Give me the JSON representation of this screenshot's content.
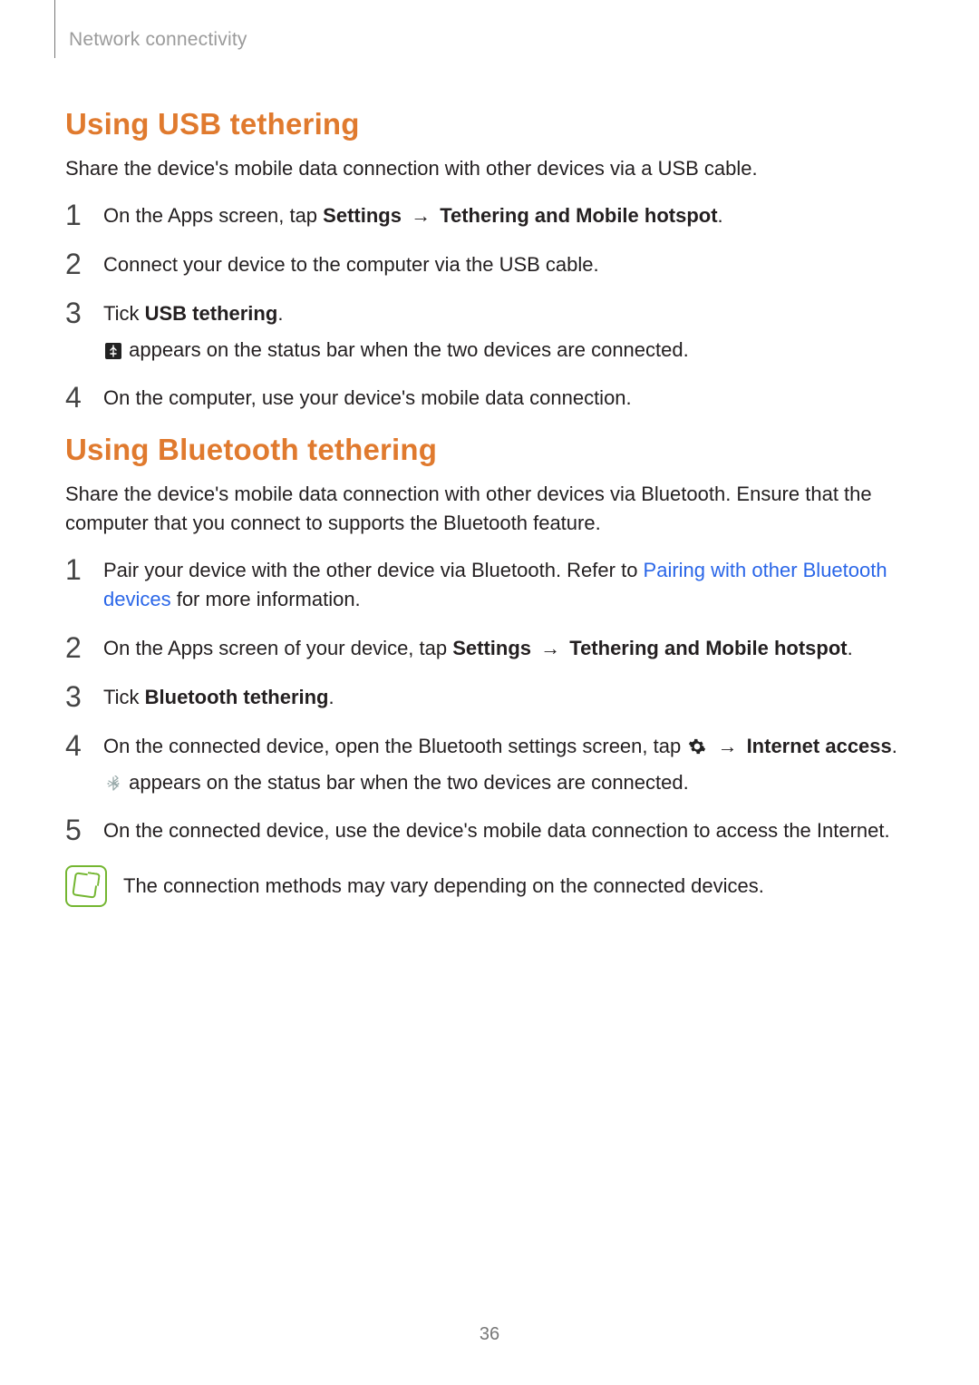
{
  "header": {
    "section": "Network connectivity"
  },
  "usb": {
    "heading": "Using USB tethering",
    "lead": "Share the device's mobile data connection with other devices via a USB cable.",
    "step1": {
      "pre": "On the Apps screen, tap ",
      "bold1": "Settings",
      "arrow": " → ",
      "bold2": "Tethering and Mobile hotspot",
      "post": "."
    },
    "step2": "Connect your device to the computer via the USB cable.",
    "step3": {
      "pre": "Tick ",
      "bold": "USB tethering",
      "post": ".",
      "sub": " appears on the status bar when the two devices are connected."
    },
    "step4": "On the computer, use your device's mobile data connection."
  },
  "bt": {
    "heading": "Using Bluetooth tethering",
    "lead": "Share the device's mobile data connection with other devices via Bluetooth. Ensure that the computer that you connect to supports the Bluetooth feature.",
    "step1": {
      "pre": "Pair your device with the other device via Bluetooth. Refer to ",
      "link": "Pairing with other Bluetooth devices",
      "post": " for more information."
    },
    "step2": {
      "pre": "On the Apps screen of your device, tap ",
      "bold1": "Settings",
      "arrow": " → ",
      "bold2": "Tethering and Mobile hotspot",
      "post": "."
    },
    "step3": {
      "pre": "Tick ",
      "bold": "Bluetooth tethering",
      "post": "."
    },
    "step4": {
      "pre": "On the connected device, open the Bluetooth settings screen, tap ",
      "arrow": " → ",
      "bold": "Internet access",
      "post": ".",
      "sub": " appears on the status bar when the two devices are connected."
    },
    "step5": "On the connected device, use the device's mobile data connection to access the Internet."
  },
  "note": {
    "text": "The connection methods may vary depending on the connected devices."
  },
  "icons": {
    "usb_tether": "usb-tether-icon",
    "gear": "gear-icon",
    "bt_tether": "bt-tether-icon"
  },
  "page_number": "36"
}
